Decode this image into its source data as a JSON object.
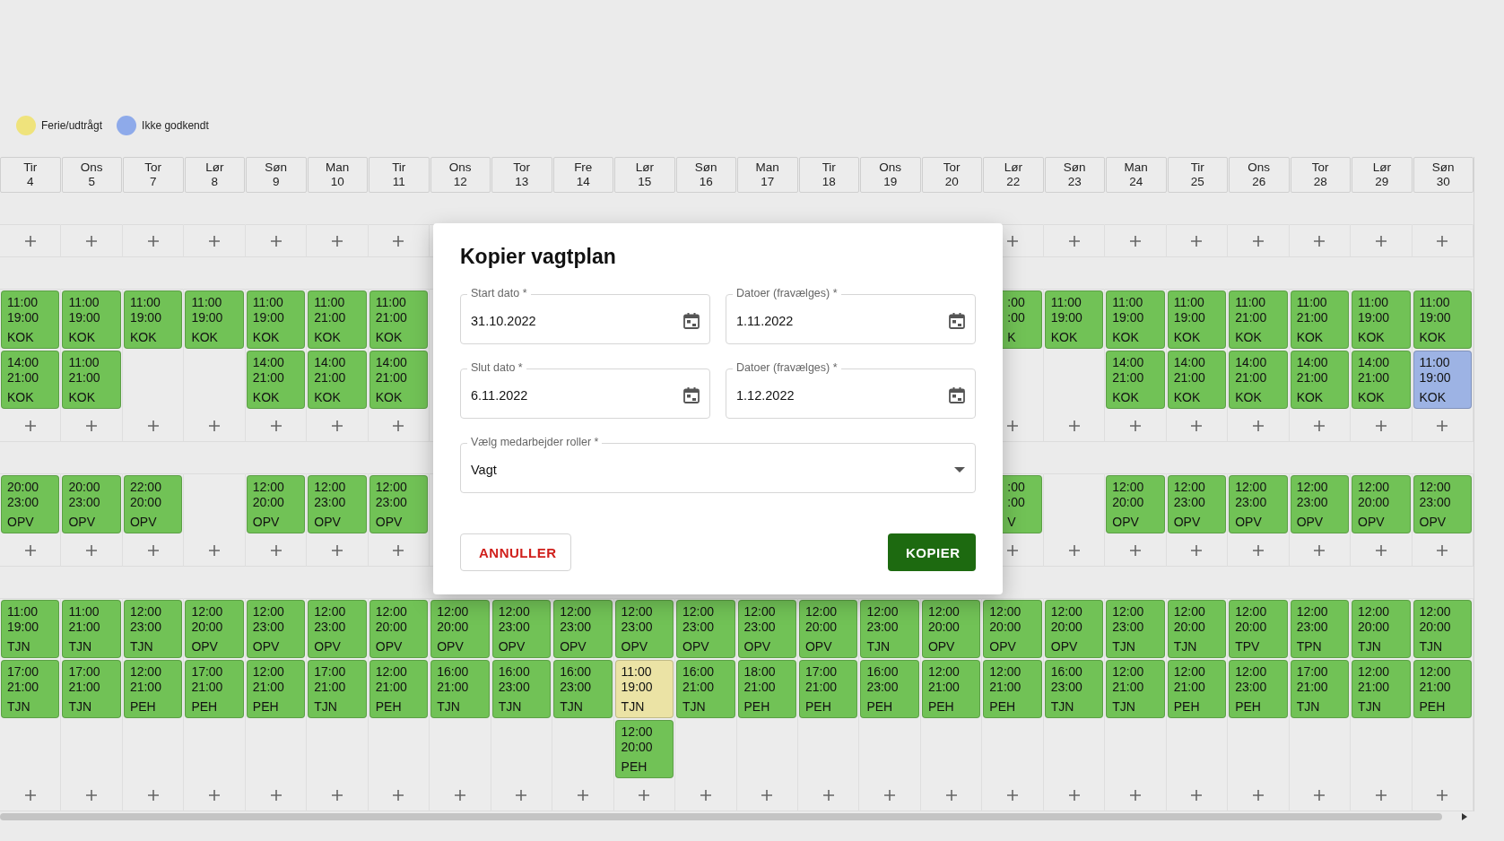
{
  "legend": [
    {
      "label": "Ferie/udtrågt",
      "color": "#efe37c"
    },
    {
      "label": "Ikke godkendt",
      "color": "#8eaaea"
    }
  ],
  "days": [
    {
      "day": "Tir",
      "date": "4"
    },
    {
      "day": "Ons",
      "date": "5"
    },
    {
      "day": "Tor",
      "date": "7"
    },
    {
      "day": "Lør",
      "date": "8"
    },
    {
      "day": "Søn",
      "date": "9"
    },
    {
      "day": "Man",
      "date": "10"
    },
    {
      "day": "Tir",
      "date": "11"
    },
    {
      "day": "Ons",
      "date": "12"
    },
    {
      "day": "Tor",
      "date": "13"
    },
    {
      "day": "Fre",
      "date": "14"
    },
    {
      "day": "Lør",
      "date": "15"
    },
    {
      "day": "Søn",
      "date": "16"
    },
    {
      "day": "Man",
      "date": "17"
    },
    {
      "day": "Tir",
      "date": "18"
    },
    {
      "day": "Ons",
      "date": "19"
    },
    {
      "day": "Tor",
      "date": "20"
    },
    {
      "day": "Lør",
      "date": "22"
    },
    {
      "day": "Søn",
      "date": "23"
    },
    {
      "day": "Man",
      "date": "24"
    },
    {
      "day": "Tir",
      "date": "25"
    },
    {
      "day": "Ons",
      "date": "26"
    },
    {
      "day": "Tor",
      "date": "28"
    },
    {
      "day": "Lør",
      "date": "29"
    },
    {
      "day": "Søn",
      "date": "30"
    }
  ],
  "sections": [
    {
      "rows": [
        [
          {
            "kind": "shift",
            "start": "11:00",
            "end": "19:00",
            "role": "KOK",
            "color": "#71c256"
          },
          {
            "kind": "shift",
            "start": "11:00",
            "end": "19:00",
            "role": "KOK",
            "color": "#71c256"
          },
          {
            "kind": "shift",
            "start": "11:00",
            "end": "19:00",
            "role": "KOK",
            "color": "#71c256"
          },
          {
            "kind": "shift",
            "start": "11:00",
            "end": "19:00",
            "role": "KOK",
            "color": "#71c256"
          },
          {
            "kind": "shift",
            "start": "11:00",
            "end": "19:00",
            "role": "KOK",
            "color": "#71c256"
          },
          {
            "kind": "shift",
            "start": "11:00",
            "end": "21:00",
            "role": "KOK",
            "color": "#71c256"
          },
          {
            "kind": "shift",
            "start": "11:00",
            "end": "21:00",
            "role": "KOK",
            "color": "#71c256"
          },
          null,
          null,
          null,
          null,
          null,
          null,
          null,
          null,
          null,
          {
            "kind": "clipped",
            "start": ":00",
            "end": ":00",
            "role": "K",
            "color": "#71c256"
          },
          {
            "kind": "shift",
            "start": "11:00",
            "end": "19:00",
            "role": "KOK",
            "color": "#71c256"
          },
          {
            "kind": "shift",
            "start": "11:00",
            "end": "19:00",
            "role": "KOK",
            "color": "#71c256"
          },
          {
            "kind": "shift",
            "start": "11:00",
            "end": "19:00",
            "role": "KOK",
            "color": "#71c256"
          },
          {
            "kind": "shift",
            "start": "11:00",
            "end": "21:00",
            "role": "KOK",
            "color": "#71c256"
          },
          {
            "kind": "shift",
            "start": "11:00",
            "end": "21:00",
            "role": "KOK",
            "color": "#71c256"
          },
          {
            "kind": "shift",
            "start": "11:00",
            "end": "19:00",
            "role": "KOK",
            "color": "#71c256"
          },
          {
            "kind": "shift",
            "start": "11:00",
            "end": "19:00",
            "role": "KOK",
            "color": "#71c256"
          }
        ],
        [
          {
            "kind": "shift",
            "start": "14:00",
            "end": "21:00",
            "role": "KOK",
            "color": "#71c256"
          },
          {
            "kind": "shift",
            "start": "11:00",
            "end": "21:00",
            "role": "KOK",
            "color": "#71c256"
          },
          null,
          null,
          {
            "kind": "shift",
            "start": "14:00",
            "end": "21:00",
            "role": "KOK",
            "color": "#71c256"
          },
          {
            "kind": "shift",
            "start": "14:00",
            "end": "21:00",
            "role": "KOK",
            "color": "#71c256"
          },
          {
            "kind": "shift",
            "start": "14:00",
            "end": "21:00",
            "role": "KOK",
            "color": "#71c256"
          },
          null,
          null,
          null,
          null,
          null,
          null,
          null,
          null,
          null,
          null,
          null,
          {
            "kind": "shift",
            "start": "14:00",
            "end": "21:00",
            "role": "KOK",
            "color": "#71c256"
          },
          {
            "kind": "shift",
            "start": "14:00",
            "end": "21:00",
            "role": "KOK",
            "color": "#71c256"
          },
          {
            "kind": "shift",
            "start": "14:00",
            "end": "21:00",
            "role": "KOK",
            "color": "#71c256"
          },
          {
            "kind": "shift",
            "start": "14:00",
            "end": "21:00",
            "role": "KOK",
            "color": "#71c256"
          },
          {
            "kind": "shift",
            "start": "14:00",
            "end": "21:00",
            "role": "KOK",
            "color": "#71c256"
          },
          {
            "kind": "shift",
            "start": "11:00",
            "end": "19:00",
            "role": "KOK",
            "color": "#9db3e4"
          }
        ]
      ]
    },
    {
      "rows": [
        [
          {
            "kind": "shift",
            "start": "20:00",
            "end": "23:00",
            "role": "OPV",
            "color": "#71c256"
          },
          {
            "kind": "shift",
            "start": "20:00",
            "end": "23:00",
            "role": "OPV",
            "color": "#71c256"
          },
          {
            "kind": "shift",
            "start": "22:00",
            "end": "20:00",
            "role": "OPV",
            "color": "#71c256"
          },
          null,
          {
            "kind": "shift",
            "start": "12:00",
            "end": "20:00",
            "role": "OPV",
            "color": "#71c256"
          },
          {
            "kind": "shift",
            "start": "12:00",
            "end": "23:00",
            "role": "OPV",
            "color": "#71c256"
          },
          {
            "kind": "shift",
            "start": "12:00",
            "end": "23:00",
            "role": "OPV",
            "color": "#71c256"
          },
          null,
          null,
          null,
          null,
          null,
          null,
          null,
          null,
          null,
          {
            "kind": "clipped",
            "start": ":00",
            "end": ":00",
            "role": "V",
            "color": "#71c256"
          },
          null,
          {
            "kind": "shift",
            "start": "12:00",
            "end": "20:00",
            "role": "OPV",
            "color": "#71c256"
          },
          {
            "kind": "shift",
            "start": "12:00",
            "end": "23:00",
            "role": "OPV",
            "color": "#71c256"
          },
          {
            "kind": "shift",
            "start": "12:00",
            "end": "23:00",
            "role": "OPV",
            "color": "#71c256"
          },
          {
            "kind": "shift",
            "start": "12:00",
            "end": "23:00",
            "role": "OPV",
            "color": "#71c256"
          },
          {
            "kind": "shift",
            "start": "12:00",
            "end": "20:00",
            "role": "OPV",
            "color": "#71c256"
          },
          {
            "kind": "shift",
            "start": "12:00",
            "end": "23:00",
            "role": "OPV",
            "color": "#71c256"
          }
        ]
      ]
    },
    {
      "rows": [
        [
          {
            "kind": "shift",
            "start": "11:00",
            "end": "19:00",
            "role": "TJN",
            "color": "#71c256"
          },
          {
            "kind": "shift",
            "start": "11:00",
            "end": "21:00",
            "role": "TJN",
            "color": "#71c256"
          },
          {
            "kind": "shift",
            "start": "12:00",
            "end": "23:00",
            "role": "TJN",
            "color": "#71c256"
          },
          {
            "kind": "shift",
            "start": "12:00",
            "end": "20:00",
            "role": "OPV",
            "color": "#71c256"
          },
          {
            "kind": "shift",
            "start": "12:00",
            "end": "23:00",
            "role": "OPV",
            "color": "#71c256"
          },
          {
            "kind": "shift",
            "start": "12:00",
            "end": "23:00",
            "role": "OPV",
            "color": "#71c256"
          },
          {
            "kind": "shift",
            "start": "12:00",
            "end": "20:00",
            "role": "OPV",
            "color": "#71c256"
          },
          {
            "kind": "shift",
            "start": "12:00",
            "end": "20:00",
            "role": "OPV",
            "color": "#71c256"
          },
          {
            "kind": "shift",
            "start": "12:00",
            "end": "23:00",
            "role": "OPV",
            "color": "#71c256"
          },
          {
            "kind": "shift",
            "start": "12:00",
            "end": "23:00",
            "role": "OPV",
            "color": "#71c256"
          },
          {
            "kind": "shift",
            "start": "12:00",
            "end": "23:00",
            "role": "OPV",
            "color": "#71c256"
          },
          {
            "kind": "shift",
            "start": "12:00",
            "end": "23:00",
            "role": "OPV",
            "color": "#71c256"
          },
          {
            "kind": "shift",
            "start": "12:00",
            "end": "23:00",
            "role": "OPV",
            "color": "#71c256"
          },
          {
            "kind": "shift",
            "start": "12:00",
            "end": "20:00",
            "role": "OPV",
            "color": "#71c256"
          },
          {
            "kind": "shift",
            "start": "12:00",
            "end": "23:00",
            "role": "TJN",
            "color": "#71c256"
          },
          {
            "kind": "shift",
            "start": "12:00",
            "end": "20:00",
            "role": "OPV",
            "color": "#71c256"
          },
          {
            "kind": "shift",
            "start": "12:00",
            "end": "20:00",
            "role": "OPV",
            "color": "#71c256"
          },
          {
            "kind": "shift",
            "start": "12:00",
            "end": "20:00",
            "role": "OPV",
            "color": "#71c256"
          },
          {
            "kind": "shift",
            "start": "12:00",
            "end": "23:00",
            "role": "TJN",
            "color": "#71c256"
          },
          {
            "kind": "shift",
            "start": "12:00",
            "end": "20:00",
            "role": "TJN",
            "color": "#71c256"
          },
          {
            "kind": "shift",
            "start": "12:00",
            "end": "20:00",
            "role": "TPV",
            "color": "#71c256"
          },
          {
            "kind": "shift",
            "start": "12:00",
            "end": "23:00",
            "role": "TPN",
            "color": "#71c256"
          },
          {
            "kind": "shift",
            "start": "12:00",
            "end": "20:00",
            "role": "TJN",
            "color": "#71c256"
          },
          {
            "kind": "shift",
            "start": "12:00",
            "end": "20:00",
            "role": "TJN",
            "color": "#71c256"
          }
        ],
        [
          {
            "kind": "shift",
            "start": "17:00",
            "end": "21:00",
            "role": "TJN",
            "color": "#71c256"
          },
          {
            "kind": "shift",
            "start": "17:00",
            "end": "21:00",
            "role": "TJN",
            "color": "#71c256"
          },
          {
            "kind": "shift",
            "start": "12:00",
            "end": "21:00",
            "role": "PEH",
            "color": "#71c256"
          },
          {
            "kind": "shift",
            "start": "17:00",
            "end": "21:00",
            "role": "PEH",
            "color": "#71c256"
          },
          {
            "kind": "shift",
            "start": "12:00",
            "end": "21:00",
            "role": "PEH",
            "color": "#71c256"
          },
          {
            "kind": "shift",
            "start": "17:00",
            "end": "21:00",
            "role": "TJN",
            "color": "#71c256"
          },
          {
            "kind": "shift",
            "start": "12:00",
            "end": "21:00",
            "role": "PEH",
            "color": "#71c256"
          },
          {
            "kind": "shift",
            "start": "16:00",
            "end": "21:00",
            "role": "TJN",
            "color": "#71c256"
          },
          {
            "kind": "shift",
            "start": "16:00",
            "end": "23:00",
            "role": "TJN",
            "color": "#71c256"
          },
          {
            "kind": "shift",
            "start": "16:00",
            "end": "23:00",
            "role": "TJN",
            "color": "#71c256"
          },
          {
            "kind": "shift",
            "start": "11:00",
            "end": "19:00",
            "role": "TJN",
            "color": "#ebe3a5"
          },
          {
            "kind": "shift",
            "start": "16:00",
            "end": "21:00",
            "role": "TJN",
            "color": "#71c256"
          },
          {
            "kind": "shift",
            "start": "18:00",
            "end": "21:00",
            "role": "PEH",
            "color": "#71c256"
          },
          {
            "kind": "shift",
            "start": "17:00",
            "end": "21:00",
            "role": "PEH",
            "color": "#71c256"
          },
          {
            "kind": "shift",
            "start": "16:00",
            "end": "23:00",
            "role": "PEH",
            "color": "#71c256"
          },
          {
            "kind": "shift",
            "start": "12:00",
            "end": "21:00",
            "role": "PEH",
            "color": "#71c256"
          },
          {
            "kind": "shift",
            "start": "12:00",
            "end": "21:00",
            "role": "PEH",
            "color": "#71c256"
          },
          {
            "kind": "shift",
            "start": "16:00",
            "end": "23:00",
            "role": "TJN",
            "color": "#71c256"
          },
          {
            "kind": "shift",
            "start": "12:00",
            "end": "21:00",
            "role": "TJN",
            "color": "#71c256"
          },
          {
            "kind": "shift",
            "start": "12:00",
            "end": "21:00",
            "role": "PEH",
            "color": "#71c256"
          },
          {
            "kind": "shift",
            "start": "12:00",
            "end": "23:00",
            "role": "PEH",
            "color": "#71c256"
          },
          {
            "kind": "shift",
            "start": "17:00",
            "end": "21:00",
            "role": "TJN",
            "color": "#71c256"
          },
          {
            "kind": "shift",
            "start": "12:00",
            "end": "21:00",
            "role": "TJN",
            "color": "#71c256"
          },
          {
            "kind": "shift",
            "start": "12:00",
            "end": "21:00",
            "role": "PEH",
            "color": "#71c256"
          }
        ],
        [
          null,
          null,
          null,
          null,
          null,
          null,
          null,
          null,
          null,
          null,
          {
            "kind": "shift",
            "start": "12:00",
            "end": "20:00",
            "role": "PEH",
            "color": "#71c256"
          },
          null,
          null,
          null,
          null,
          null,
          null,
          null,
          null,
          null,
          null,
          null,
          null,
          null
        ]
      ]
    }
  ],
  "dialog": {
    "title": "Kopier vagtplan",
    "fields": [
      {
        "kind": "date",
        "label": "Start dato *",
        "value": "31.10.2022"
      },
      {
        "kind": "date",
        "label": "Datoer (fravælges) *",
        "value": "1.11.2022"
      },
      {
        "kind": "date",
        "label": "Slut dato *",
        "value": "6.11.2022"
      },
      {
        "kind": "date",
        "label": "Datoer (fravælges) *",
        "value": "1.12.2022"
      },
      {
        "kind": "select",
        "label": "Vælg medarbejder roller *",
        "value": "Vagt"
      }
    ],
    "buttons": [
      {
        "kind": "cancel",
        "label": "ANNULLER"
      },
      {
        "kind": "primary",
        "label": "KOPIER"
      }
    ]
  }
}
